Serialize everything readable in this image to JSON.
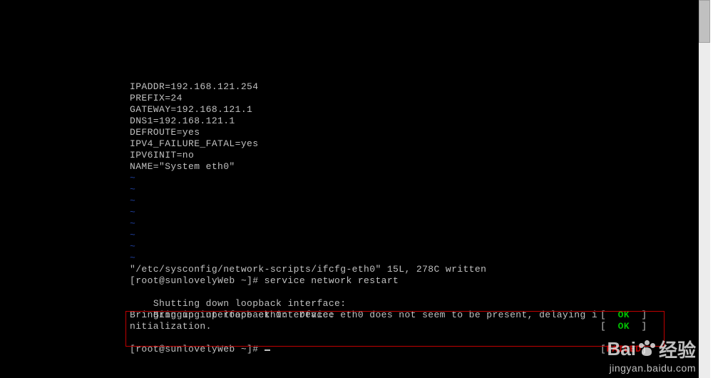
{
  "config": {
    "ipaddr": "IPADDR=192.168.121.254",
    "prefix": "PREFIX=24",
    "gateway": "GATEWAY=192.168.121.1",
    "dns1": "DNS1=192.168.121.1",
    "defroute": "DEFROUTE=yes",
    "ipv4ff": "IPV4_FAILURE_FATAL=yes",
    "ipv6init": "IPV6INIT=no",
    "name": "NAME=\"System eth0\""
  },
  "tilde": "~",
  "vim_status": "\"/etc/sysconfig/network-scripts/ifcfg-eth0\" 15L, 278C written",
  "prompt1": "[root@sunlovelyWeb ~]# service network restart",
  "svc": {
    "line1": "Shutting down loopback interface:",
    "line2": "Bringing up loopback interface:",
    "line3a": "Bringing up interface eth0:  Device eth0 does not seem to be present, delaying i",
    "line3b": "nitialization."
  },
  "status": {
    "ok": "[  OK  ]",
    "open": "[",
    "ok_word": "OK",
    "failed_word": "FAILED",
    "close": "]"
  },
  "prompt2": "[root@sunlovelyWeb ~]# ",
  "watermark": {
    "brand_prefix": "Bai",
    "brand_suffix": "经验",
    "url": "jingyan.baidu.com"
  }
}
